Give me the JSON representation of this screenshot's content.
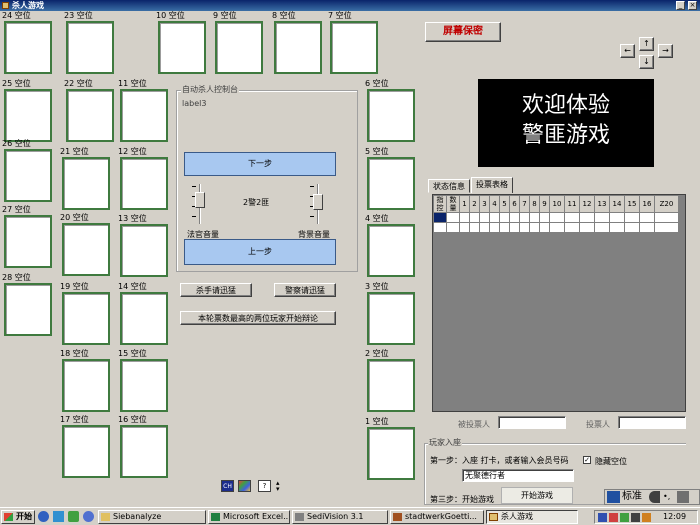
{
  "window": {
    "title": "杀人游戏",
    "min_glyph": "_",
    "close_glyph": "×"
  },
  "seats": [
    {
      "label": "24 空位"
    },
    {
      "label": "23 空位"
    },
    {
      "label": "10 空位"
    },
    {
      "label": "9 空位"
    },
    {
      "label": "8 空位"
    },
    {
      "label": "7 空位"
    },
    {
      "label": "25 空位"
    },
    {
      "label": "22 空位"
    },
    {
      "label": "11 空位"
    },
    {
      "label": "6 空位"
    },
    {
      "label": "26 空位"
    },
    {
      "label": "21 空位"
    },
    {
      "label": "12 空位"
    },
    {
      "label": "5 空位"
    },
    {
      "label": "27 空位"
    },
    {
      "label": "20 空位"
    },
    {
      "label": "13 空位"
    },
    {
      "label": "4 空位"
    },
    {
      "label": "28 空位"
    },
    {
      "label": "19 空位"
    },
    {
      "label": "14 空位"
    },
    {
      "label": "3 空位"
    },
    {
      "label": "18 空位"
    },
    {
      "label": "15 空位"
    },
    {
      "label": "2 空位"
    },
    {
      "label": "17 空位"
    },
    {
      "label": "16 空位"
    },
    {
      "label": "1 空位"
    }
  ],
  "screensaver_button": "屏幕保密",
  "arrows": {
    "left": "←",
    "up": "↑",
    "right": "→",
    "down": "↓"
  },
  "control_panel": {
    "title": "自动杀人控制台",
    "label": "label3",
    "next_step": "下一步",
    "prev_step": "上一步",
    "center_text": "2警2匪",
    "judge_volume": "法官音量",
    "bg_volume": "背景音量"
  },
  "actions": {
    "killer_confirm": "杀手请迅猛",
    "police_confirm": "警察请迅猛",
    "top_two_debate": "本轮票数最高的两位玩家开始辩论"
  },
  "welcome": {
    "line1": "欢迎体验",
    "line2": "警匪游戏"
  },
  "tabs": [
    "状态信息",
    "投票表格"
  ],
  "vote_table": {
    "corner1": "指控",
    "corner2": "数量",
    "columns": [
      "1",
      "2",
      "3",
      "4",
      "5",
      "6",
      "7",
      "8",
      "9",
      "10",
      "11",
      "12",
      "13",
      "14",
      "15",
      "16",
      "Z20"
    ]
  },
  "vote_footer": {
    "voted_label": "被投票人",
    "voter_label": "投票人"
  },
  "join": {
    "title": "玩家入座",
    "step1": "第一步：入座 打卡，或者输入会员号码",
    "member_value": "无聚德行者",
    "hide_seat": "隐藏空位",
    "step3": "第三步：开始游戏",
    "start_button": "开始游戏"
  },
  "tray_tools": {
    "ch_label": "CH",
    "help_label": "?"
  },
  "ime": {
    "mode_label": "标准"
  },
  "taskbar": {
    "start": "开始",
    "tasks": [
      {
        "label": "Siebanalyze"
      },
      {
        "label": "Microsoft Excel..."
      },
      {
        "label": "SediVision 3.1"
      },
      {
        "label": "stadtwerkGoetti..."
      },
      {
        "label": "杀人游戏"
      }
    ],
    "clock": "12:09"
  },
  "colors": {
    "seat_border": "#3f7a3f",
    "title_bar": "#0a246a",
    "screensaver_text": "#c00000",
    "step_button": "#a8c8f0"
  }
}
